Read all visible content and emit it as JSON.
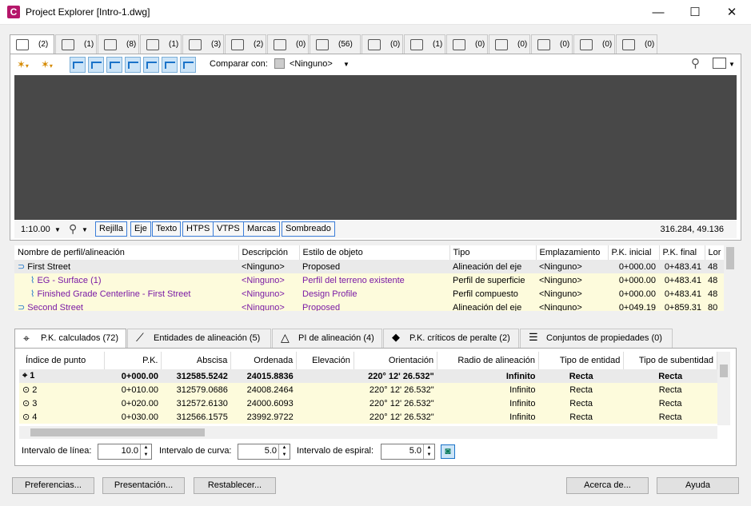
{
  "window": {
    "title": "Project Explorer [Intro-1.dwg]",
    "minimize": "—",
    "maximize": "☐",
    "close": "✕"
  },
  "object_tabs": [
    {
      "icon": "alignment-icon",
      "count": "(2)"
    },
    {
      "icon": "profile-view-icon",
      "count": "(1)"
    },
    {
      "icon": "profile-icon",
      "count": "(8)"
    },
    {
      "icon": "corridor-icon",
      "count": "(1)"
    },
    {
      "icon": "assembly-icon",
      "count": "(3)"
    },
    {
      "icon": "surface-icon",
      "count": "(2)"
    },
    {
      "icon": "featureline-icon",
      "count": "(0)"
    },
    {
      "icon": "pipe-network-icon",
      "count": "(56)"
    },
    {
      "icon": "parcel-icon",
      "count": "(0)"
    },
    {
      "icon": "structure-icon",
      "count": "(1)"
    },
    {
      "icon": "pressure-pipe-icon",
      "count": "(0)"
    },
    {
      "icon": "sample-line-icon",
      "count": "(0)"
    },
    {
      "icon": "point-group-icon",
      "count": "(0)"
    },
    {
      "icon": "table-icon",
      "count": "(0)"
    },
    {
      "icon": "report-icon",
      "count": "(0)"
    }
  ],
  "toolbar": {
    "compare_label": "Comparar con:",
    "compare_value": "<Ninguno>"
  },
  "statusbar": {
    "scale": "1:10.00",
    "toggles": [
      "Rejilla",
      "Eje",
      "Texto",
      "HTPS",
      "VTPS",
      "Marcas",
      "Sombreado"
    ],
    "coords": "316.284, 49.136"
  },
  "grid1": {
    "headers": [
      "Nombre de perfil/alineación",
      "Descripción",
      "Estilo de objeto",
      "Tipo",
      "Emplazamiento",
      "P.K. inicial",
      "P.K. final",
      "Lor"
    ],
    "rows": [
      [
        "First Street",
        "<Ninguno>",
        "Proposed",
        "Alineación del eje",
        "<Ninguno>",
        "0+000.00",
        "0+483.41",
        "48"
      ],
      [
        "EG - Surface (1)",
        "<Ninguno>",
        "Perfil del terreno existente",
        "Perfil de superficie",
        "<Ninguno>",
        "0+000.00",
        "0+483.41",
        "48"
      ],
      [
        "Finished Grade Centerline - First Street",
        "<Ninguno>",
        "Design Profile",
        "Perfil compuesto",
        "<Ninguno>",
        "0+000.00",
        "0+483.41",
        "48"
      ],
      [
        "Second Street",
        "<Ninguno>",
        "Proposed",
        "Alineación del eje",
        "<Ninguno>",
        "0+049.19",
        "0+859.31",
        "80"
      ]
    ]
  },
  "lower_tabs": [
    "P.K. calculados (72)",
    "Entidades de alineación (5)",
    "PI de alineación (4)",
    "P.K. críticos de peralte (2)",
    "Conjuntos de propiedades (0)"
  ],
  "grid2": {
    "headers": [
      "Índice de punto",
      "P.K.",
      "Abscisa",
      "Ordenada",
      "Elevación",
      "Orientación",
      "Radio de alineación",
      "Tipo de entidad",
      "Tipo de subentidad"
    ],
    "rows": [
      [
        "1",
        "0+000.00",
        "312585.5242",
        "24015.8836",
        "",
        "220° 12' 26.532\"",
        "Infinito",
        "Recta",
        "Recta"
      ],
      [
        "2",
        "0+010.00",
        "312579.0686",
        "24008.2464",
        "",
        "220° 12' 26.532\"",
        "Infinito",
        "Recta",
        "Recta"
      ],
      [
        "3",
        "0+020.00",
        "312572.6130",
        "24000.6093",
        "",
        "220° 12' 26.532\"",
        "Infinito",
        "Recta",
        "Recta"
      ],
      [
        "4",
        "0+030.00",
        "312566.1575",
        "23992.9722",
        "",
        "220° 12' 26.532\"",
        "Infinito",
        "Recta",
        "Recta"
      ]
    ]
  },
  "intervals": {
    "line_label": "Intervalo de línea:",
    "line_value": "10.0",
    "curve_label": "Intervalo de curva:",
    "curve_value": "5.0",
    "spiral_label": "Intervalo de espiral:",
    "spiral_value": "5.0"
  },
  "buttons": {
    "prefs": "Preferencias...",
    "presentation": "Presentación...",
    "reset": "Restablecer...",
    "about": "Acerca de...",
    "help": "Ayuda"
  }
}
